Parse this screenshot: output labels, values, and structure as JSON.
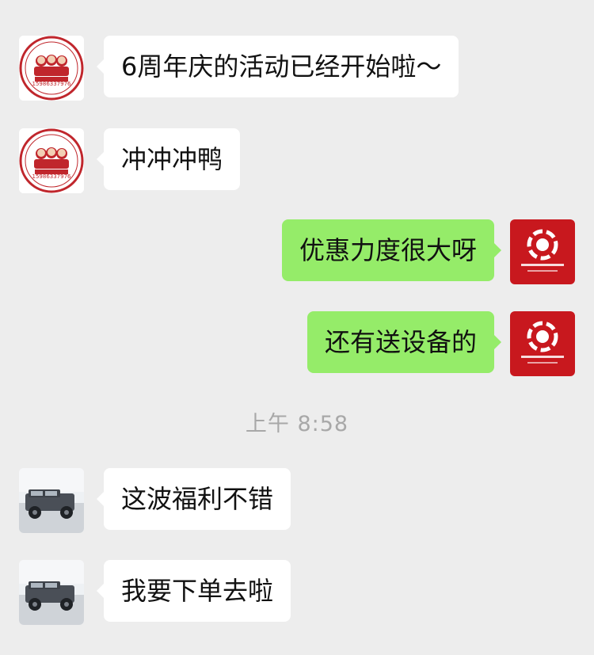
{
  "messages": [
    {
      "side": "in",
      "avatar": "seal-avatar",
      "text": "6周年庆的活动已经开始啦～"
    },
    {
      "side": "in",
      "avatar": "seal-avatar",
      "text": "冲冲冲鸭"
    },
    {
      "side": "out",
      "avatar": "brand-logo-avatar",
      "text": "优惠力度很大呀"
    },
    {
      "side": "out",
      "avatar": "brand-logo-avatar",
      "text": "还有送设备的"
    },
    {
      "side": "in",
      "avatar": "car-photo-avatar",
      "text": "这波福利不错"
    },
    {
      "side": "in",
      "avatar": "car-photo-avatar",
      "text": "我要下单去啦"
    }
  ],
  "timestamp": "上午 8:58",
  "avatars": {
    "seal_phone": "15986337976",
    "colors": {
      "seal_red": "#c0262c",
      "logo_red": "#c8181e",
      "bubble_green": "#95ec69",
      "bubble_white": "#ffffff",
      "background": "#ededed"
    }
  }
}
